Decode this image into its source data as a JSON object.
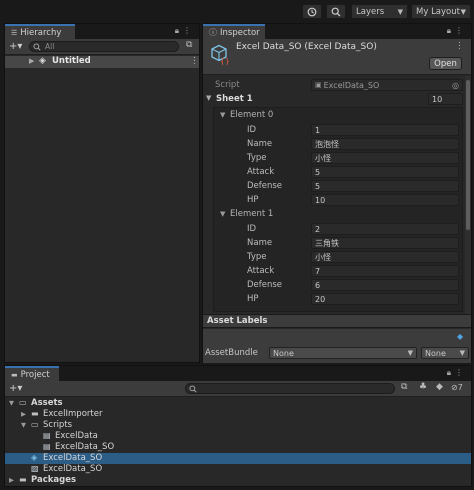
{
  "toolbar": {
    "history_icon": "history-icon",
    "search_icon": "search-icon",
    "layers_label": "Layers",
    "layout_label": "My Layout"
  },
  "hierarchy": {
    "tab_label": "Hierarchy",
    "search_placeholder": "All",
    "scene_name": "Untitled"
  },
  "inspector": {
    "tab_label": "Inspector",
    "object_title": "Excel Data_SO (Excel Data_SO)",
    "open_label": "Open",
    "script_label": "Script",
    "script_value": "ExcelData_SO",
    "sheet_label": "Sheet 1",
    "sheet_count": "10",
    "elements": [
      {
        "label": "Element 0",
        "fields": [
          {
            "name": "ID",
            "value": "1"
          },
          {
            "name": "Name",
            "value": "泡泡怪"
          },
          {
            "name": "Type",
            "value": "小怪"
          },
          {
            "name": "Attack",
            "value": "5"
          },
          {
            "name": "Defense",
            "value": "5"
          },
          {
            "name": "HP",
            "value": "10"
          }
        ]
      },
      {
        "label": "Element 1",
        "fields": [
          {
            "name": "ID",
            "value": "2"
          },
          {
            "name": "Name",
            "value": "三角铁"
          },
          {
            "name": "Type",
            "value": "小怪"
          },
          {
            "name": "Attack",
            "value": "7"
          },
          {
            "name": "Defense",
            "value": "6"
          },
          {
            "name": "HP",
            "value": "20"
          }
        ]
      }
    ],
    "asset_labels": "Asset Labels",
    "asset_bundle_label": "AssetBundle",
    "bundle_value": "None",
    "variant_value": "None"
  },
  "project": {
    "tab_label": "Project",
    "hidden_count": "7",
    "tree": [
      {
        "label": "Assets",
        "bold": true,
        "indent": 0,
        "arrow": "▼",
        "icon": "folder-open-icon"
      },
      {
        "label": "ExcelImporter",
        "indent": 1,
        "arrow": "▶",
        "icon": "folder-icon"
      },
      {
        "label": "Scripts",
        "indent": 1,
        "arrow": "▼",
        "icon": "folder-open-icon"
      },
      {
        "label": "ExcelData",
        "indent": 2,
        "arrow": "",
        "icon": "script-file-icon"
      },
      {
        "label": "ExcelData_SO",
        "indent": 2,
        "arrow": "",
        "icon": "script-file-icon"
      },
      {
        "label": "ExcelData_SO",
        "indent": 1,
        "arrow": "",
        "icon": "scriptable-object-icon",
        "selected": true
      },
      {
        "label": "ExcelData_SO",
        "indent": 1,
        "arrow": "",
        "icon": "asset-file-icon"
      },
      {
        "label": "Packages",
        "bold": true,
        "indent": 0,
        "arrow": "▶",
        "icon": "folder-icon"
      }
    ]
  }
}
